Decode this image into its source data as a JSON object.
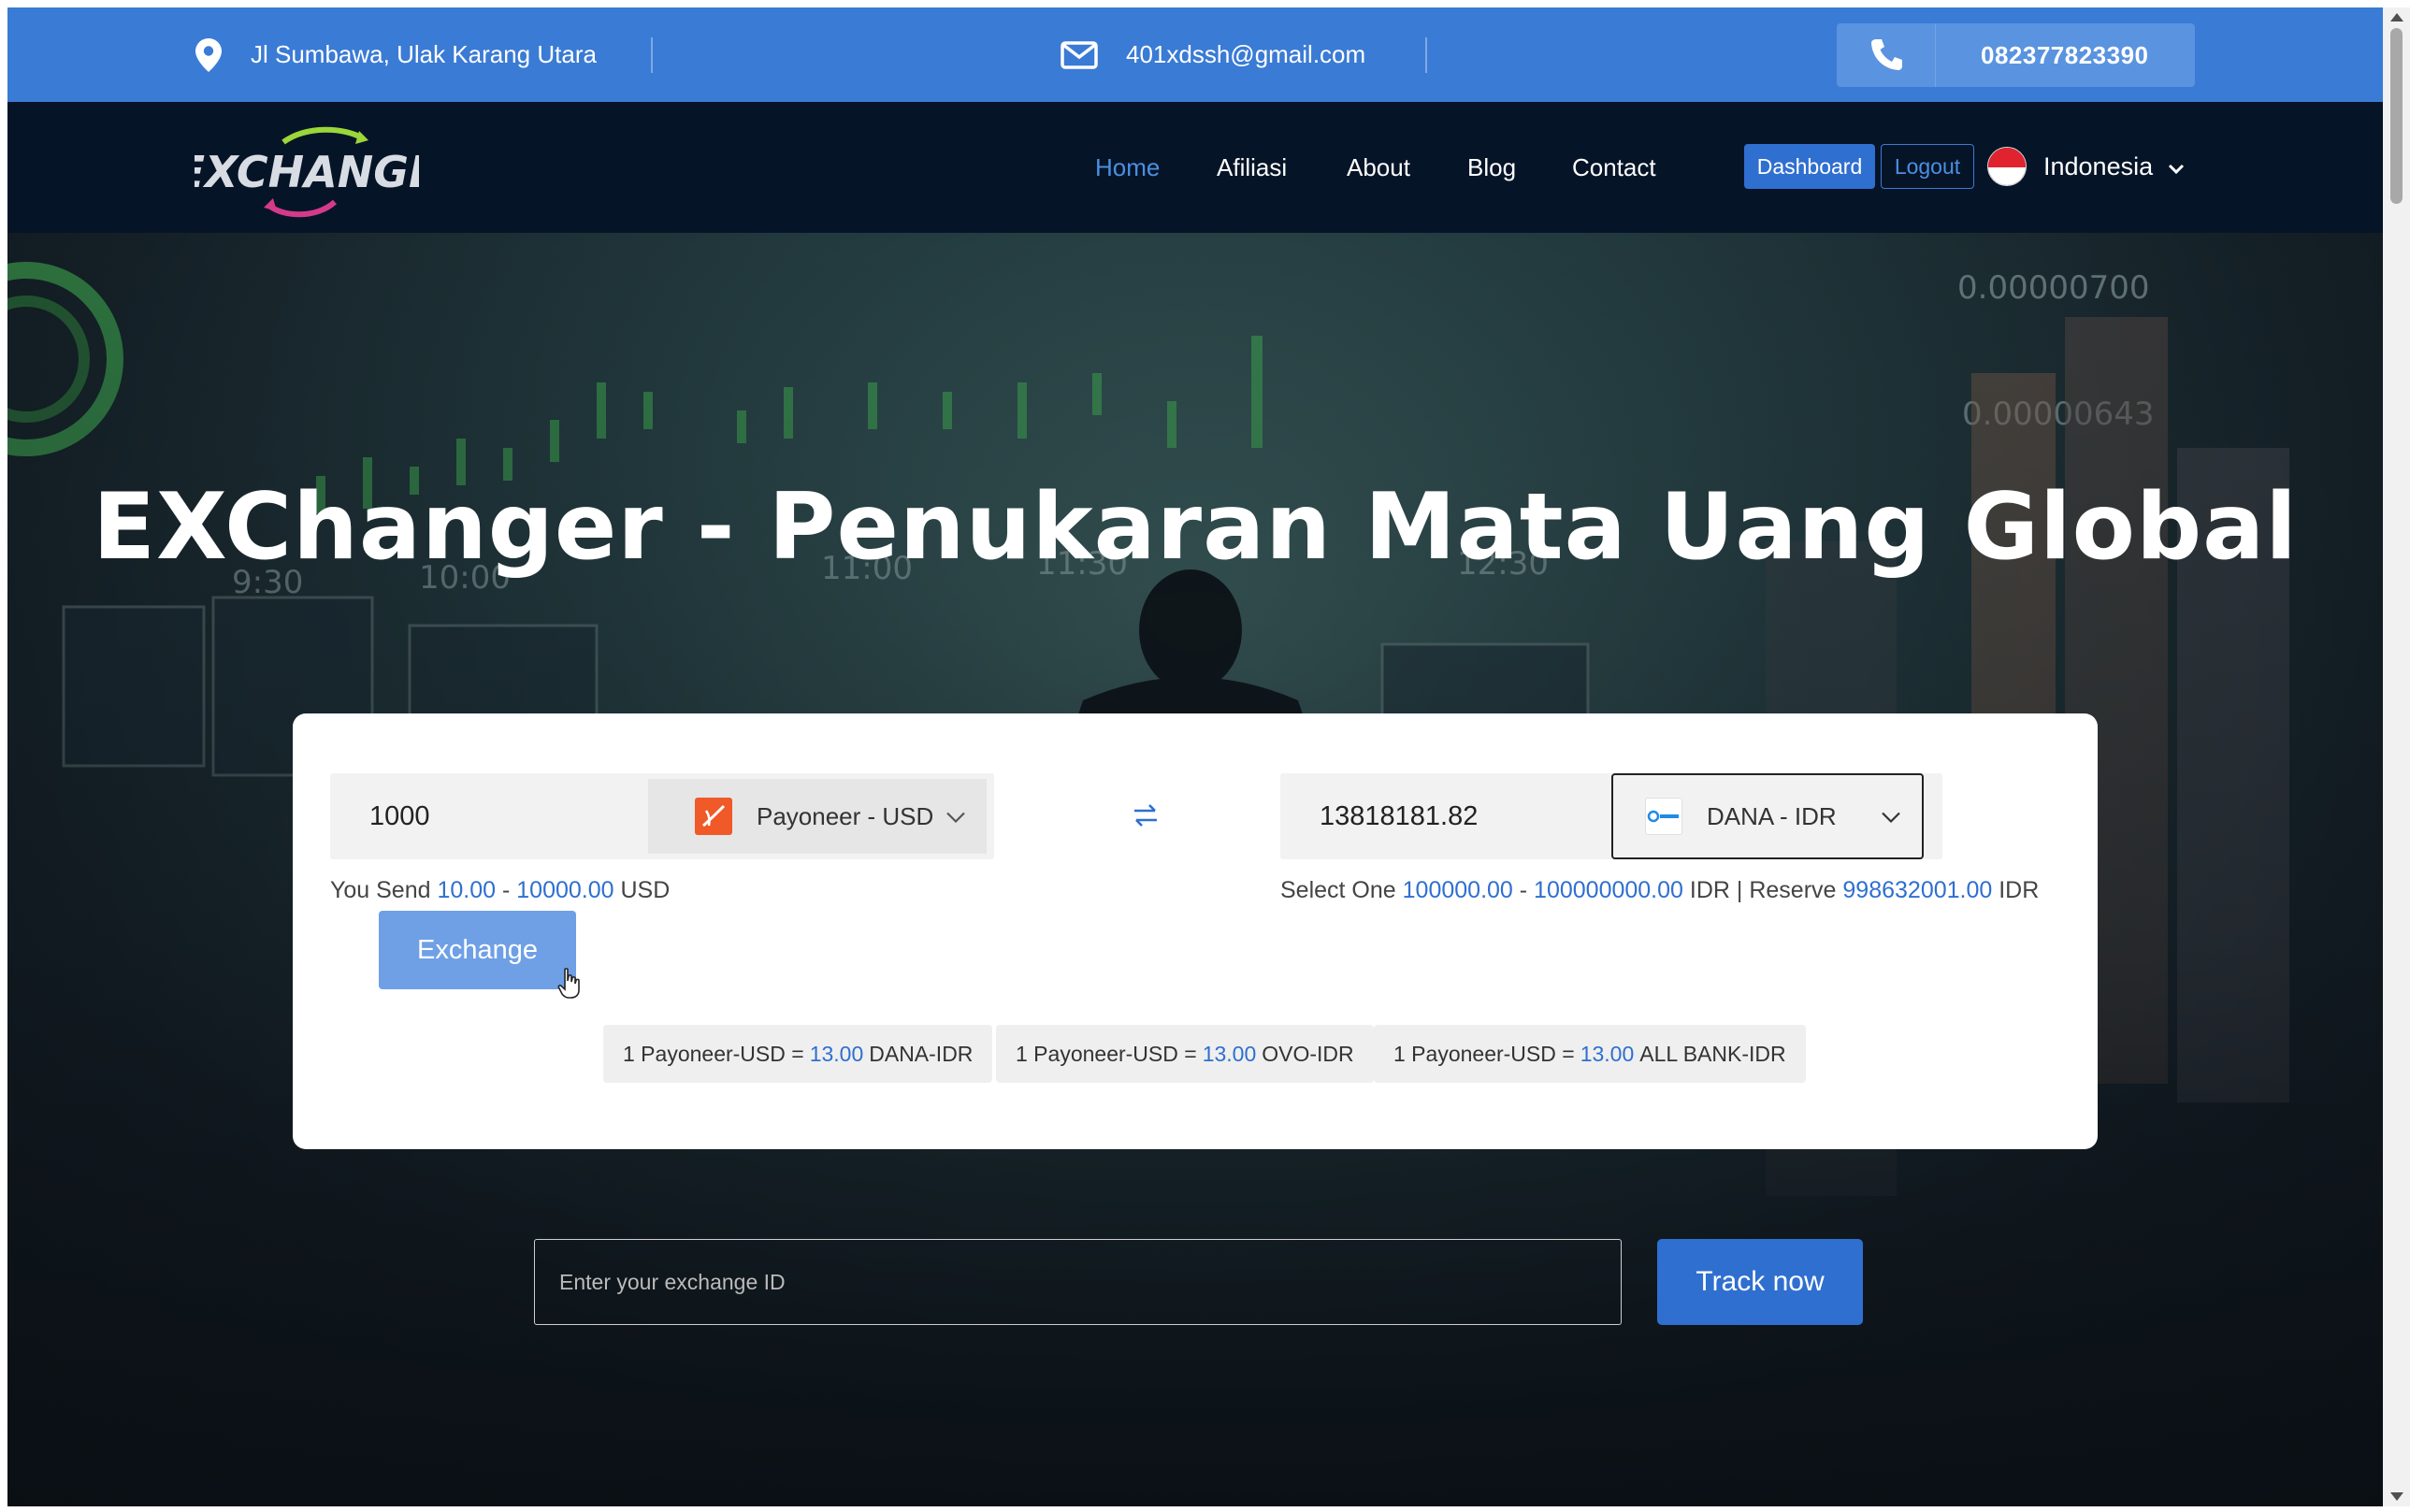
{
  "topbar": {
    "address": "Jl Sumbawa, Ulak Karang Utara",
    "email": "401xdssh@gmail.com",
    "phone": "082377823390"
  },
  "nav": {
    "logo_text": "EXCHANGE",
    "links": [
      "Home",
      "Afiliasi",
      "About",
      "Blog",
      "Contact"
    ],
    "active": "Home",
    "dashboard": "Dashboard",
    "logout": "Logout",
    "language": "Indonesia"
  },
  "hero": {
    "title": "EXChanger - Penukaran Mata Uang Global"
  },
  "exchange": {
    "send_amount": "1000",
    "send_currency": "Payoneer - USD",
    "send_hint_prefix": "You Send",
    "send_min": "10.00",
    "send_max": "10000.00",
    "send_unit": "USD",
    "receive_amount": "13818181.82",
    "receive_currency": "DANA - IDR",
    "receive_hint_prefix": "Select One",
    "receive_min": "100000.00",
    "receive_max": "100000000.00",
    "receive_unit": "IDR",
    "reserve_label": "Reserve",
    "reserve_value": "998632001.00",
    "reserve_unit": "IDR",
    "button": "Exchange",
    "rates": [
      {
        "left": "1 Payoneer-USD =",
        "value": "13.00",
        "right": "DANA-IDR"
      },
      {
        "left": "1 Payoneer-USD =",
        "value": "13.00",
        "right": "OVO-IDR"
      },
      {
        "left": "1 Payoneer-USD =",
        "value": "13.00",
        "right": "ALL BANK-IDR"
      }
    ]
  },
  "track": {
    "placeholder": "Enter your exchange ID",
    "button": "Track now"
  },
  "colors": {
    "topbar": "#3a7bd5",
    "navbar": "#061428",
    "accent": "#2f6fd0"
  }
}
